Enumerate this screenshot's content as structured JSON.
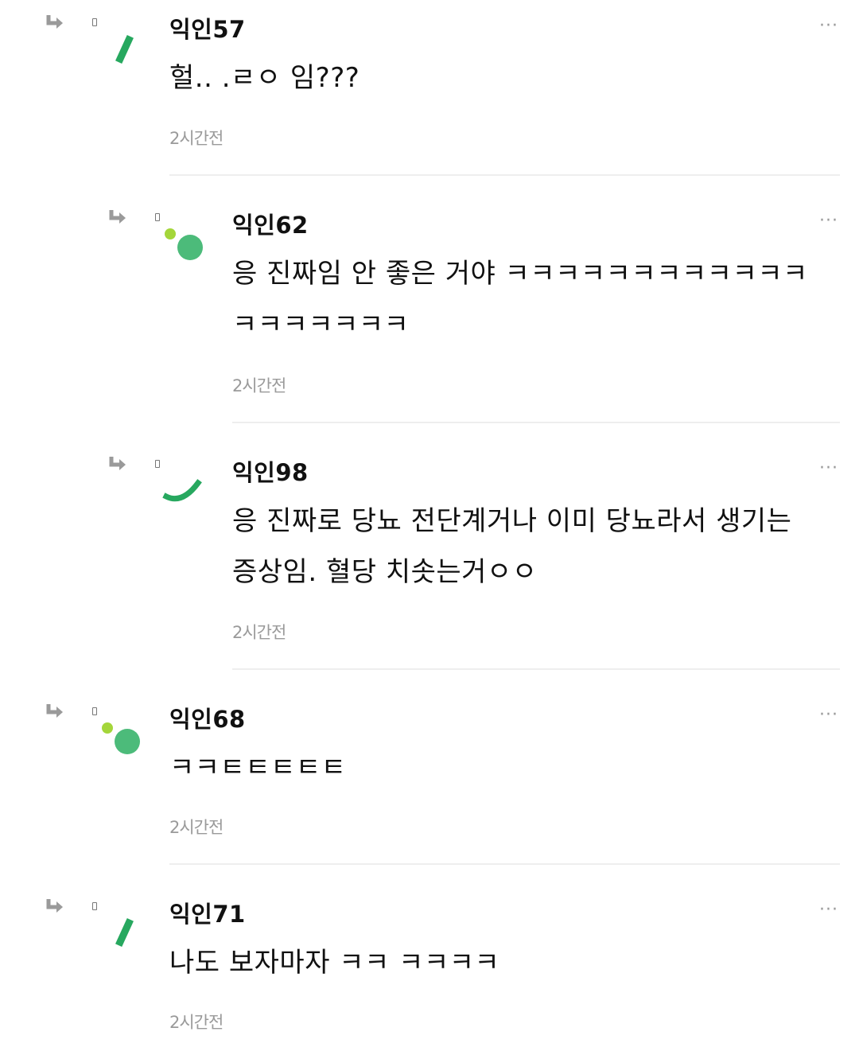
{
  "comments": [
    {
      "nickname": "익인57",
      "text": "헐.. .ㄹㅇ 임???",
      "time": "2시간전",
      "more": "···",
      "avatar": "green-dash-icon"
    },
    {
      "nickname": "익인62",
      "text": "응 진짜임 안 좋은 거야 ㅋㅋㅋㅋㅋㅋㅋㅋㅋㅋㅋㅋ\nㅋㅋㅋㅋㅋㅋㅋ",
      "time": "2시간전",
      "more": "···",
      "avatar": "green-dots-icon"
    },
    {
      "nickname": "익인98",
      "text": "응 진짜로 당뇨 전단계거나 이미 당뇨라서 생기는\n증상임. 혈당 치솟는거ㅇㅇ",
      "time": "2시간전",
      "more": "···",
      "avatar": "green-arc-icon"
    },
    {
      "nickname": "익인68",
      "text": "ㅋㅋㅌㅌㅌㅌㅌ",
      "time": "2시간전",
      "more": "···",
      "avatar": "green-dots-icon"
    },
    {
      "nickname": "익인71",
      "text": "나도 보자마자 ㅋㅋ ㅋㅋㅋㅋ",
      "time": "2시간전",
      "more": "···",
      "avatar": "green-dash-icon"
    }
  ],
  "colors": {
    "accent_green": "#27a85f",
    "avatar_green": "#4cbb7a",
    "avatar_lime": "#a4d63a",
    "reply_icon_gray": "#9a9a9a",
    "timestamp_gray": "#9a9a9a",
    "divider_gray": "#eeeeee"
  }
}
